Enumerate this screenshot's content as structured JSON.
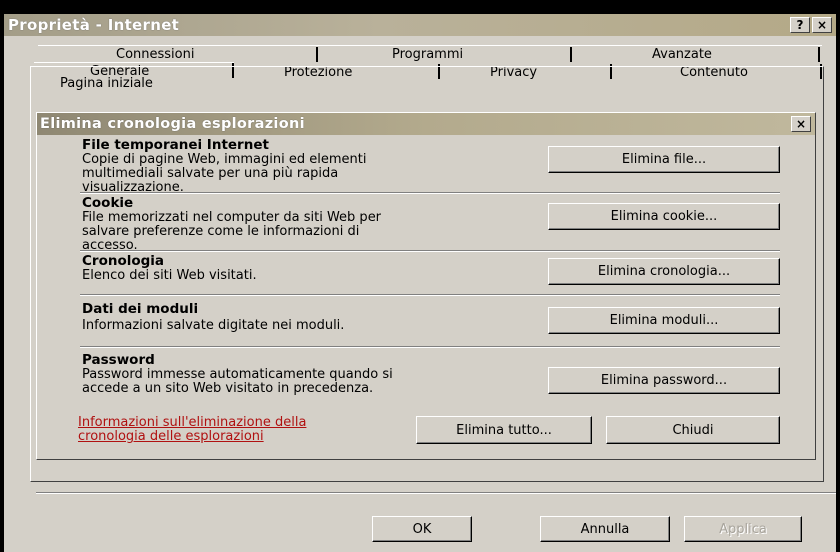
{
  "outer": {
    "title": "Proprietà - Internet",
    "help_button": "?",
    "close_button": "×"
  },
  "tabs": {
    "row1": [
      "Connessioni",
      "Programmi",
      "Avanzate"
    ],
    "row2": [
      "Generale",
      "Protezione",
      "Privacy",
      "Contenuto"
    ]
  },
  "panel": {
    "group_label": "Pagina iniziale"
  },
  "inner": {
    "title": "Elimina cronologia esplorazioni",
    "close_button": "×",
    "sections": [
      {
        "title": "File temporanei Internet",
        "desc_lines": [
          "Copie di pagine Web, immagini ed elementi",
          "multimediali salvate per una più rapida",
          "visualizzazione."
        ],
        "button": "Elimina file..."
      },
      {
        "title": "Cookie",
        "desc_lines": [
          "File memorizzati nel computer da siti Web per",
          "salvare preferenze come le informazioni di",
          "accesso."
        ],
        "button": "Elimina cookie..."
      },
      {
        "title": "Cronologia",
        "desc_lines": [
          "Elenco dei siti Web visitati."
        ],
        "button": "Elimina cronologia..."
      },
      {
        "title": "Dati dei moduli",
        "desc_lines": [
          "Informazioni salvate digitate nei moduli."
        ],
        "button": "Elimina moduli..."
      },
      {
        "title": "Password",
        "desc_lines": [
          "Password immesse automaticamente quando si",
          "accede a un sito Web visitato in precedenza."
        ],
        "button": "Elimina password..."
      }
    ],
    "info_link_lines": [
      "Informazioni sull'eliminazione della",
      "cronologia delle esplorazioni"
    ],
    "delete_all_button": "Elimina tutto...",
    "close_dialog_button": "Chiudi"
  },
  "footer": {
    "ok": "OK",
    "cancel": "Annulla",
    "apply": "Applica"
  },
  "colors": {
    "face": "#d4d0c8",
    "link": "#b01010",
    "titlebar": "#b4a987"
  }
}
